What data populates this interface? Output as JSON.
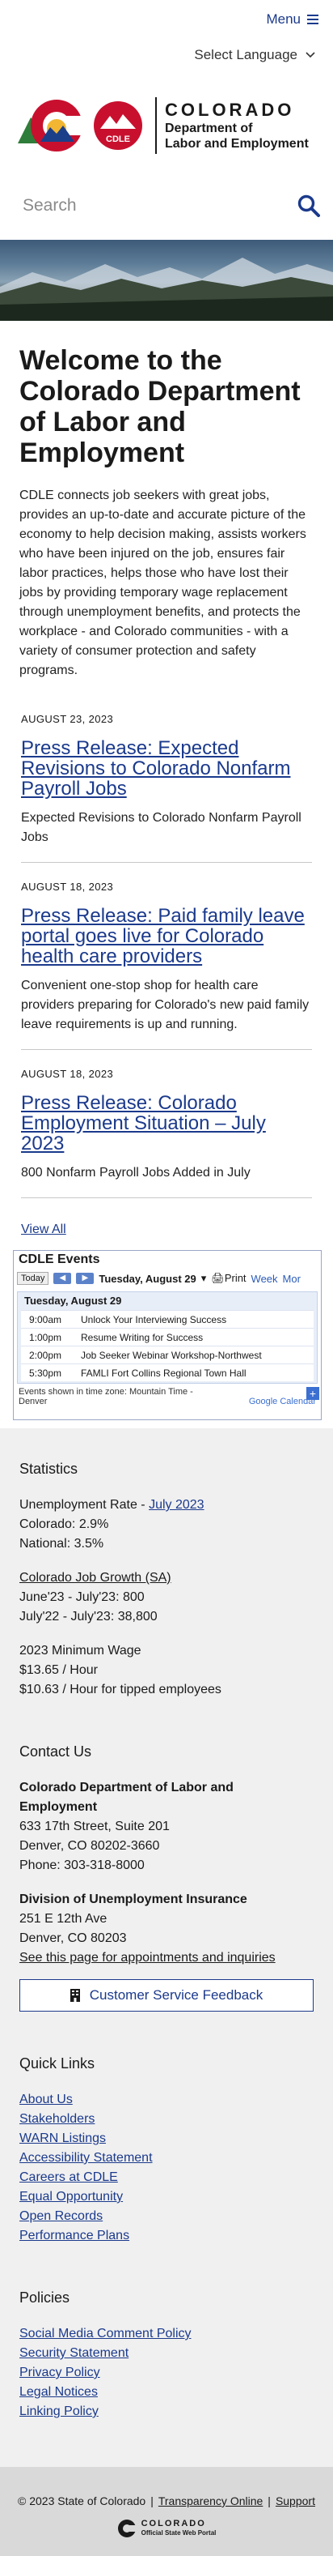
{
  "header": {
    "menu_label": "Menu",
    "language_label": "Select Language",
    "logo_colorado": "COLORADO",
    "logo_dept_line1": "Department of",
    "logo_dept_line2": "Labor and Employment",
    "logo_badge": "CDLE",
    "search_placeholder": "Search"
  },
  "welcome": {
    "title": "Welcome to the Colorado Department of Labor and Employment",
    "body": "CDLE connects job seekers with great jobs, provides an up-to-date and accurate picture of the economy to help decision making, assists workers who have been injured on the job, ensures fair labor practices, helps those who have lost their jobs by providing temporary wage replacement through unemployment benefits, and protects the workplace - and Colorado communities - with a variety of consumer protection and safety programs."
  },
  "news": [
    {
      "date": "AUGUST 23, 2023",
      "title": "Press Release: Expected Revisions to Colorado Nonfarm Payroll Jobs",
      "summary": "Expected Revisions to Colorado Nonfarm Payroll Jobs"
    },
    {
      "date": "AUGUST 18, 2023",
      "title": "Press Release: Paid family leave portal goes live for Colorado health care providers",
      "summary": "Convenient one-stop shop for health care providers preparing for Colorado's new paid family leave requirements is up and running."
    },
    {
      "date": "AUGUST 18, 2023",
      "title": "Press Release: Colorado Employment Situation – July 2023",
      "summary": "800 Nonfarm Payroll Jobs Added in July"
    }
  ],
  "view_all": "View All",
  "calendar": {
    "title": "CDLE Events",
    "today": "Today",
    "current_date": "Tuesday, August 29",
    "print": "Print",
    "tab_week": "Week",
    "tab_more": "Mor",
    "day_heading": "Tuesday, August 29",
    "events": [
      {
        "time": "9:00am",
        "title": "Unlock Your Interviewing Success"
      },
      {
        "time": "1:00pm",
        "title": "Resume Writing for Success"
      },
      {
        "time": "2:00pm",
        "title": "Job Seeker Webinar Workshop-Northwest"
      },
      {
        "time": "5:30pm",
        "title": "FAMLI Fort Collins Regional Town Hall"
      }
    ],
    "timezone_note": "Events shown in time zone: Mountain Time - Denver",
    "google_label": "Google Calendar"
  },
  "statistics": {
    "heading": "Statistics",
    "unemployment_label": "Unemployment Rate - ",
    "unemployment_link": "July 2023",
    "colorado": "Colorado: 2.9%",
    "national": "National: 3.5%",
    "job_growth_link": "Colorado Job Growth (SA)",
    "growth1": "June'23 - July'23: 800",
    "growth2": "July'22 - July'23: 38,800",
    "min_wage_label": "2023 Minimum Wage",
    "min_wage": "$13.65 / Hour",
    "tipped_wage": "$10.63 / Hour for tipped employees"
  },
  "contact": {
    "heading": "Contact Us",
    "org": "Colorado Department of Labor and Employment",
    "addr1": "633 17th Street, Suite 201",
    "addr2": "Denver, CO  80202-3660",
    "phone": "Phone: 303-318-8000",
    "div_name": "Division of Unemployment Insurance",
    "div_addr1": "251 E 12th Ave",
    "div_addr2": "Denver, CO  80203",
    "appointments_link": "See this page for appointments and inquiries",
    "feedback_button": "Customer Service Feedback"
  },
  "quick_links": {
    "heading": "Quick Links",
    "items": [
      "About Us",
      "Stakeholders",
      "WARN Listings",
      "Accessibility Statement",
      "Careers at CDLE",
      "Equal Opportunity",
      "Open Records",
      "Performance Plans"
    ]
  },
  "policies": {
    "heading": "Policies",
    "items": [
      "Social Media Comment Policy",
      "Security Statement",
      "Privacy Policy",
      "Legal Notices",
      "Linking Policy"
    ]
  },
  "footer": {
    "copyright": "© 2023 State of Colorado",
    "transparency": "Transparency Online",
    "support": "Support",
    "state_logo_line1": "COLORADO",
    "state_logo_line2": "Official State Web Portal"
  },
  "colors": {
    "link_blue": "#1b3a8c",
    "logo_red": "#c8102e",
    "logo_gold": "#f2b632",
    "logo_green": "#2f7d3a"
  }
}
